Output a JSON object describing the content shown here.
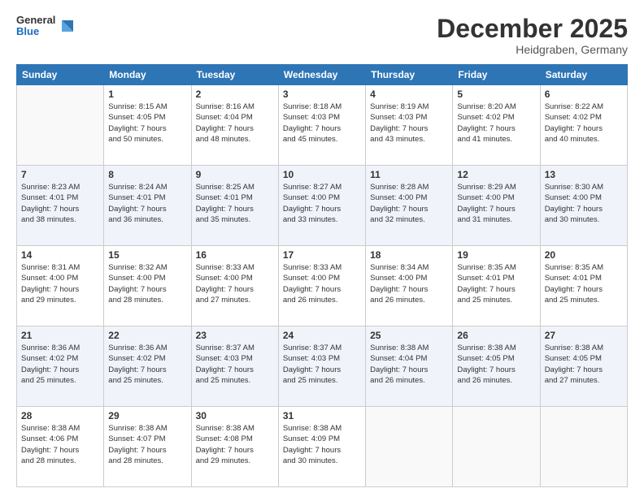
{
  "header": {
    "logo_line1": "General",
    "logo_line2": "Blue",
    "month": "December 2025",
    "location": "Heidgraben, Germany"
  },
  "days_of_week": [
    "Sunday",
    "Monday",
    "Tuesday",
    "Wednesday",
    "Thursday",
    "Friday",
    "Saturday"
  ],
  "weeks": [
    [
      {
        "day": "",
        "info": ""
      },
      {
        "day": "1",
        "info": "Sunrise: 8:15 AM\nSunset: 4:05 PM\nDaylight: 7 hours\nand 50 minutes."
      },
      {
        "day": "2",
        "info": "Sunrise: 8:16 AM\nSunset: 4:04 PM\nDaylight: 7 hours\nand 48 minutes."
      },
      {
        "day": "3",
        "info": "Sunrise: 8:18 AM\nSunset: 4:03 PM\nDaylight: 7 hours\nand 45 minutes."
      },
      {
        "day": "4",
        "info": "Sunrise: 8:19 AM\nSunset: 4:03 PM\nDaylight: 7 hours\nand 43 minutes."
      },
      {
        "day": "5",
        "info": "Sunrise: 8:20 AM\nSunset: 4:02 PM\nDaylight: 7 hours\nand 41 minutes."
      },
      {
        "day": "6",
        "info": "Sunrise: 8:22 AM\nSunset: 4:02 PM\nDaylight: 7 hours\nand 40 minutes."
      }
    ],
    [
      {
        "day": "7",
        "info": "Sunrise: 8:23 AM\nSunset: 4:01 PM\nDaylight: 7 hours\nand 38 minutes."
      },
      {
        "day": "8",
        "info": "Sunrise: 8:24 AM\nSunset: 4:01 PM\nDaylight: 7 hours\nand 36 minutes."
      },
      {
        "day": "9",
        "info": "Sunrise: 8:25 AM\nSunset: 4:01 PM\nDaylight: 7 hours\nand 35 minutes."
      },
      {
        "day": "10",
        "info": "Sunrise: 8:27 AM\nSunset: 4:00 PM\nDaylight: 7 hours\nand 33 minutes."
      },
      {
        "day": "11",
        "info": "Sunrise: 8:28 AM\nSunset: 4:00 PM\nDaylight: 7 hours\nand 32 minutes."
      },
      {
        "day": "12",
        "info": "Sunrise: 8:29 AM\nSunset: 4:00 PM\nDaylight: 7 hours\nand 31 minutes."
      },
      {
        "day": "13",
        "info": "Sunrise: 8:30 AM\nSunset: 4:00 PM\nDaylight: 7 hours\nand 30 minutes."
      }
    ],
    [
      {
        "day": "14",
        "info": "Sunrise: 8:31 AM\nSunset: 4:00 PM\nDaylight: 7 hours\nand 29 minutes."
      },
      {
        "day": "15",
        "info": "Sunrise: 8:32 AM\nSunset: 4:00 PM\nDaylight: 7 hours\nand 28 minutes."
      },
      {
        "day": "16",
        "info": "Sunrise: 8:33 AM\nSunset: 4:00 PM\nDaylight: 7 hours\nand 27 minutes."
      },
      {
        "day": "17",
        "info": "Sunrise: 8:33 AM\nSunset: 4:00 PM\nDaylight: 7 hours\nand 26 minutes."
      },
      {
        "day": "18",
        "info": "Sunrise: 8:34 AM\nSunset: 4:00 PM\nDaylight: 7 hours\nand 26 minutes."
      },
      {
        "day": "19",
        "info": "Sunrise: 8:35 AM\nSunset: 4:01 PM\nDaylight: 7 hours\nand 25 minutes."
      },
      {
        "day": "20",
        "info": "Sunrise: 8:35 AM\nSunset: 4:01 PM\nDaylight: 7 hours\nand 25 minutes."
      }
    ],
    [
      {
        "day": "21",
        "info": "Sunrise: 8:36 AM\nSunset: 4:02 PM\nDaylight: 7 hours\nand 25 minutes."
      },
      {
        "day": "22",
        "info": "Sunrise: 8:36 AM\nSunset: 4:02 PM\nDaylight: 7 hours\nand 25 minutes."
      },
      {
        "day": "23",
        "info": "Sunrise: 8:37 AM\nSunset: 4:03 PM\nDaylight: 7 hours\nand 25 minutes."
      },
      {
        "day": "24",
        "info": "Sunrise: 8:37 AM\nSunset: 4:03 PM\nDaylight: 7 hours\nand 25 minutes."
      },
      {
        "day": "25",
        "info": "Sunrise: 8:38 AM\nSunset: 4:04 PM\nDaylight: 7 hours\nand 26 minutes."
      },
      {
        "day": "26",
        "info": "Sunrise: 8:38 AM\nSunset: 4:05 PM\nDaylight: 7 hours\nand 26 minutes."
      },
      {
        "day": "27",
        "info": "Sunrise: 8:38 AM\nSunset: 4:05 PM\nDaylight: 7 hours\nand 27 minutes."
      }
    ],
    [
      {
        "day": "28",
        "info": "Sunrise: 8:38 AM\nSunset: 4:06 PM\nDaylight: 7 hours\nand 28 minutes."
      },
      {
        "day": "29",
        "info": "Sunrise: 8:38 AM\nSunset: 4:07 PM\nDaylight: 7 hours\nand 28 minutes."
      },
      {
        "day": "30",
        "info": "Sunrise: 8:38 AM\nSunset: 4:08 PM\nDaylight: 7 hours\nand 29 minutes."
      },
      {
        "day": "31",
        "info": "Sunrise: 8:38 AM\nSunset: 4:09 PM\nDaylight: 7 hours\nand 30 minutes."
      },
      {
        "day": "",
        "info": ""
      },
      {
        "day": "",
        "info": ""
      },
      {
        "day": "",
        "info": ""
      }
    ]
  ]
}
